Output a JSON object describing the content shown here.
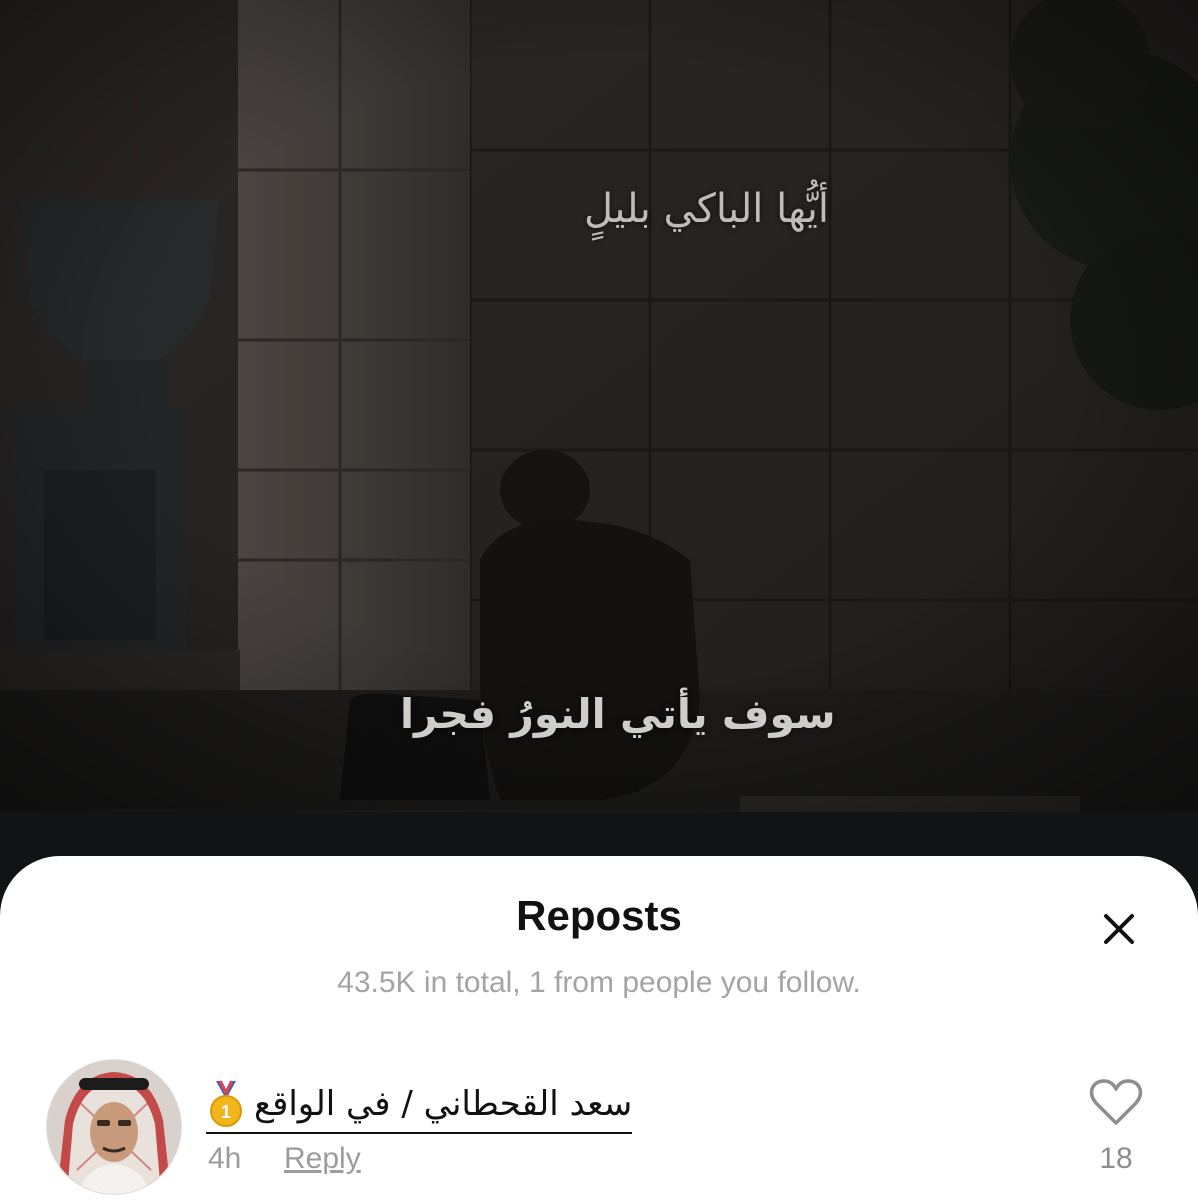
{
  "video": {
    "caption_top": "أيُّها الباكي بليلٍ",
    "caption_bottom": "سوف يأتي النورُ فجرا"
  },
  "sheet": {
    "title": "Reposts",
    "subtitle": "43.5K in total, 1 from people you follow.",
    "close_icon": "close-icon"
  },
  "reposts": [
    {
      "username": "سعد القحطاني / في الواقع",
      "badge_icon": "gold-medal-icon",
      "time": "4h",
      "reply_label": "Reply",
      "like_count": "18",
      "like_icon": "heart-outline-icon"
    }
  ],
  "colors": {
    "sheet_bg": "#ffffff",
    "title": "#111111",
    "muted": "#a3a3a8",
    "video_bg": "#1b1a19"
  }
}
